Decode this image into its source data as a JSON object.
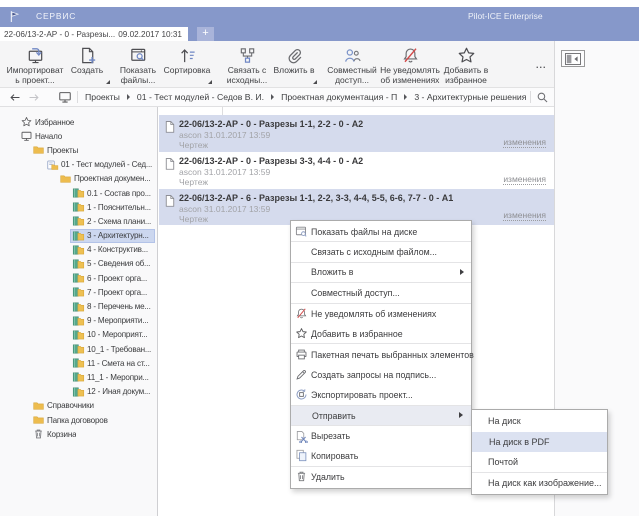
{
  "window": {
    "app_menu": "СЕРВИС",
    "title": "Pilot-ICE Enterprise",
    "tab": {
      "name": "22-06/13-2-АР - 0 - Разрезы...",
      "date": "09.02.2017 10:31"
    },
    "new_tab": "+"
  },
  "toolbar": {
    "buttons": [
      {
        "icon": "import-icon",
        "lines": [
          "Импортироват",
          "ь проект..."
        ]
      },
      {
        "icon": "create-icon",
        "lines": [
          "Создать",
          ""
        ],
        "dropdown": true
      },
      {
        "icon": "show-files-icon",
        "lines": [
          "Показать",
          "файлы..."
        ]
      },
      {
        "icon": "sort-icon",
        "lines": [
          "Сортировка",
          ""
        ],
        "dropdown": true
      },
      {
        "icon": "link-source-icon",
        "lines": [
          "Связать с",
          "исходны..."
        ]
      },
      {
        "icon": "attach-icon",
        "lines": [
          "Вложить в",
          ""
        ],
        "dropdown": true
      },
      {
        "icon": "share-icon",
        "lines": [
          "Совместный",
          "доступ..."
        ]
      },
      {
        "icon": "mute-bell-icon",
        "lines": [
          "Не уведомлять",
          "об изменениях"
        ]
      },
      {
        "icon": "favorite-icon",
        "lines": [
          "Добавить в",
          "избранное"
        ]
      }
    ],
    "overflow": "...",
    "panel_button_icon": "panel-icon"
  },
  "breadcrumb": {
    "items": [
      "Проекты",
      "01 - Тест модулей - Седов В. И.",
      "Проектная документация - П",
      "3 - Архитектурные решения"
    ]
  },
  "sidebar": {
    "items": [
      {
        "label": "Избранное",
        "icon": "star-icon",
        "level": 0
      },
      {
        "label": "Начало",
        "icon": "monitor-icon",
        "level": 0
      },
      {
        "label": "Проекты",
        "icon": "folder-icon",
        "level": 1
      },
      {
        "label": "01 - Тест модулей - Сед...",
        "icon": "project-icon",
        "level": 2
      },
      {
        "label": "Проектная докумен...",
        "icon": "folder-icon",
        "level": 3
      },
      {
        "label": "0.1 - Состав про...",
        "icon": "docset-icon",
        "level": 4
      },
      {
        "label": "1 - Пояснительн...",
        "icon": "docset-icon",
        "level": 4
      },
      {
        "label": "2 - Схема плани...",
        "icon": "docset-icon",
        "level": 4
      },
      {
        "label": "3 - Архитектурн...",
        "icon": "docset-icon",
        "level": 4,
        "selected": true
      },
      {
        "label": "4 - Конструктив...",
        "icon": "docset-icon",
        "level": 4
      },
      {
        "label": "5 - Сведения об...",
        "icon": "docset-icon",
        "level": 4
      },
      {
        "label": "6 - Проект орга...",
        "icon": "docset-icon",
        "level": 4
      },
      {
        "label": "7 - Проект орга...",
        "icon": "docset-icon",
        "level": 4
      },
      {
        "label": "8 - Перечень ме...",
        "icon": "docset-icon",
        "level": 4
      },
      {
        "label": "9 - Мероприяти...",
        "icon": "docset-icon",
        "level": 4
      },
      {
        "label": "10 - Мероприят...",
        "icon": "docset-icon",
        "level": 4
      },
      {
        "label": "10_1 - Требован...",
        "icon": "docset-icon",
        "level": 4
      },
      {
        "label": "11 - Смета на ст...",
        "icon": "docset-icon",
        "level": 4
      },
      {
        "label": "11_1 - Меропри...",
        "icon": "docset-icon",
        "level": 4
      },
      {
        "label": "12 - Иная докум...",
        "icon": "docset-icon",
        "level": 4
      },
      {
        "label": "Справочники",
        "icon": "folder-icon",
        "level": 1
      },
      {
        "label": "Папка договоров",
        "icon": "folder-icon",
        "level": 1
      },
      {
        "label": "Корзина",
        "icon": "trash-icon",
        "level": 1
      }
    ]
  },
  "files": {
    "rows": [
      {
        "title": "22-06/13-2-АР - 0 - Разрезы 1-1, 2-2 - 0 - А2",
        "meta": "ascon 31.01.2017 13:59",
        "type": "Чертеж",
        "link": "изменения",
        "selected": true
      },
      {
        "title": "22-06/13-2-АР - 0 - Разрезы 3-3, 4-4 - 0 - А2",
        "meta": "ascon 31.01.2017 13:59",
        "type": "Чертеж",
        "link": "изменения",
        "selected": false
      },
      {
        "title": "22-06/13-2-АР - 6 - Разрезы 1-1, 2-2, 3-3, 4-4, 5-5, 6-6, 7-7 - 0 - А1",
        "meta": "ascon 31.01.2017 13:59",
        "type": "Чертеж",
        "link": "изменения",
        "selected": true
      }
    ]
  },
  "context_menu": {
    "items": [
      {
        "label": "Показать файлы на диске",
        "icon": "win-disk-icon",
        "sep_after": true
      },
      {
        "label": "Связать с исходным файлом...",
        "sep_after": true
      },
      {
        "label": "Вложить в",
        "arrow": true,
        "sep_after": true
      },
      {
        "label": "Совместный доступ...",
        "sep_after": true
      },
      {
        "label": "Не уведомлять об изменениях",
        "icon": "mute-bell-icon"
      },
      {
        "label": "Добавить в избранное",
        "icon": "star-icon",
        "sep_after": true
      },
      {
        "label": "Пакетная печать выбранных элементов",
        "icon": "printer-icon"
      },
      {
        "label": "Создать запросы на подпись...",
        "icon": "pen-icon"
      },
      {
        "label": "Экспортировать проект...",
        "icon": "export-icon",
        "sep_after": true
      },
      {
        "label": "Отправить",
        "arrow": true,
        "highlighted": true,
        "sep_after": true
      },
      {
        "label": "Вырезать",
        "icon": "cut-icon"
      },
      {
        "label": "Копировать",
        "icon": "copy-icon",
        "sep_after": true
      },
      {
        "label": "Удалить",
        "icon": "trash-icon"
      }
    ]
  },
  "send_submenu": {
    "items": [
      {
        "label": "На диск"
      },
      {
        "label": "На диск в PDF",
        "highlighted": true
      },
      {
        "label": "Почтой",
        "sep_after": true
      },
      {
        "label": "На диск как изображение..."
      }
    ]
  },
  "colors": {
    "titlebar_blue": "#8698ca",
    "new_tab_blue": "#a9b4da",
    "selection_blue": "#d5dbed",
    "tree_selection": "#ccd7ef",
    "menu_highlight": "#e9ebf2",
    "submenu_highlight": "#dce2f1",
    "accent_icon_blue": "#6f87c4",
    "mute_cross_red": "#d24b4b",
    "folder_yellow": "#edbc4e",
    "book_green": "#56a88c"
  }
}
